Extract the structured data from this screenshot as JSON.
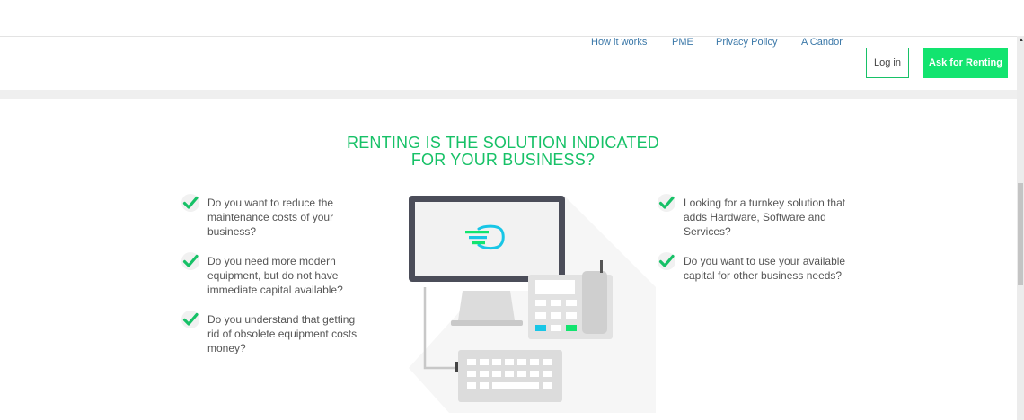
{
  "nav": {
    "links": [
      "How it works",
      "PME",
      "Privacy Policy",
      "A Candor"
    ],
    "login_label": "Log in",
    "ask_label": "Ask for Renting"
  },
  "section": {
    "title_line1": "RENTING IS THE SOLUTION INDICATED",
    "title_line2": "FOR YOUR BUSINESS?",
    "left_items": [
      "Do you want to reduce the maintenance costs of your business?",
      "Do you need more modern equipment, but do not have immediate capital available?",
      "Do you understand that getting rid of obsolete equipment costs money?"
    ],
    "right_items": [
      "Looking for a turnkey solution that adds Hardware, Software and Services?",
      "Do you want to use your available capital for other business needs?"
    ]
  },
  "colors": {
    "accent": "#12e46f",
    "title_green": "#17c167",
    "link_blue": "#3b78a8",
    "cyan": "#18c6e6"
  },
  "icons": [
    "check-icon",
    "computer-illustration",
    "candor-logo-icon"
  ]
}
